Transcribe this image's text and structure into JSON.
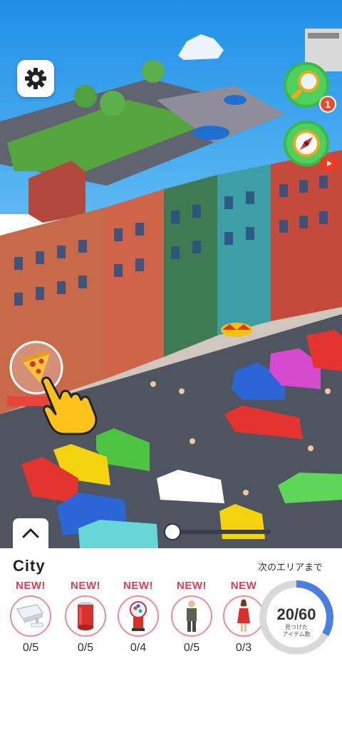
{
  "hud": {
    "notification_count": "1"
  },
  "area": {
    "title": "City",
    "next_area_label": "次のエリアまで",
    "found": 20,
    "total": 60,
    "progress_text": "20/60",
    "progress_caption_line1": "見つけた",
    "progress_caption_line2": "アイテム数"
  },
  "items": [
    {
      "badge": "NEW!",
      "count": "0/5",
      "icon": "cctv-camera-icon"
    },
    {
      "badge": "NEW!",
      "count": "0/5",
      "icon": "red-can-icon"
    },
    {
      "badge": "NEW!",
      "count": "0/4",
      "icon": "gumball-machine-icon"
    },
    {
      "badge": "NEW!",
      "count": "0/5",
      "icon": "man-in-suit-icon"
    },
    {
      "badge": "NEW",
      "count": "0/3",
      "icon": "woman-in-red-dress-icon"
    }
  ],
  "colors": {
    "accent_new": "#e33a55",
    "progress_fill": "#4a7fe0",
    "progress_track": "#d9d9d9"
  }
}
